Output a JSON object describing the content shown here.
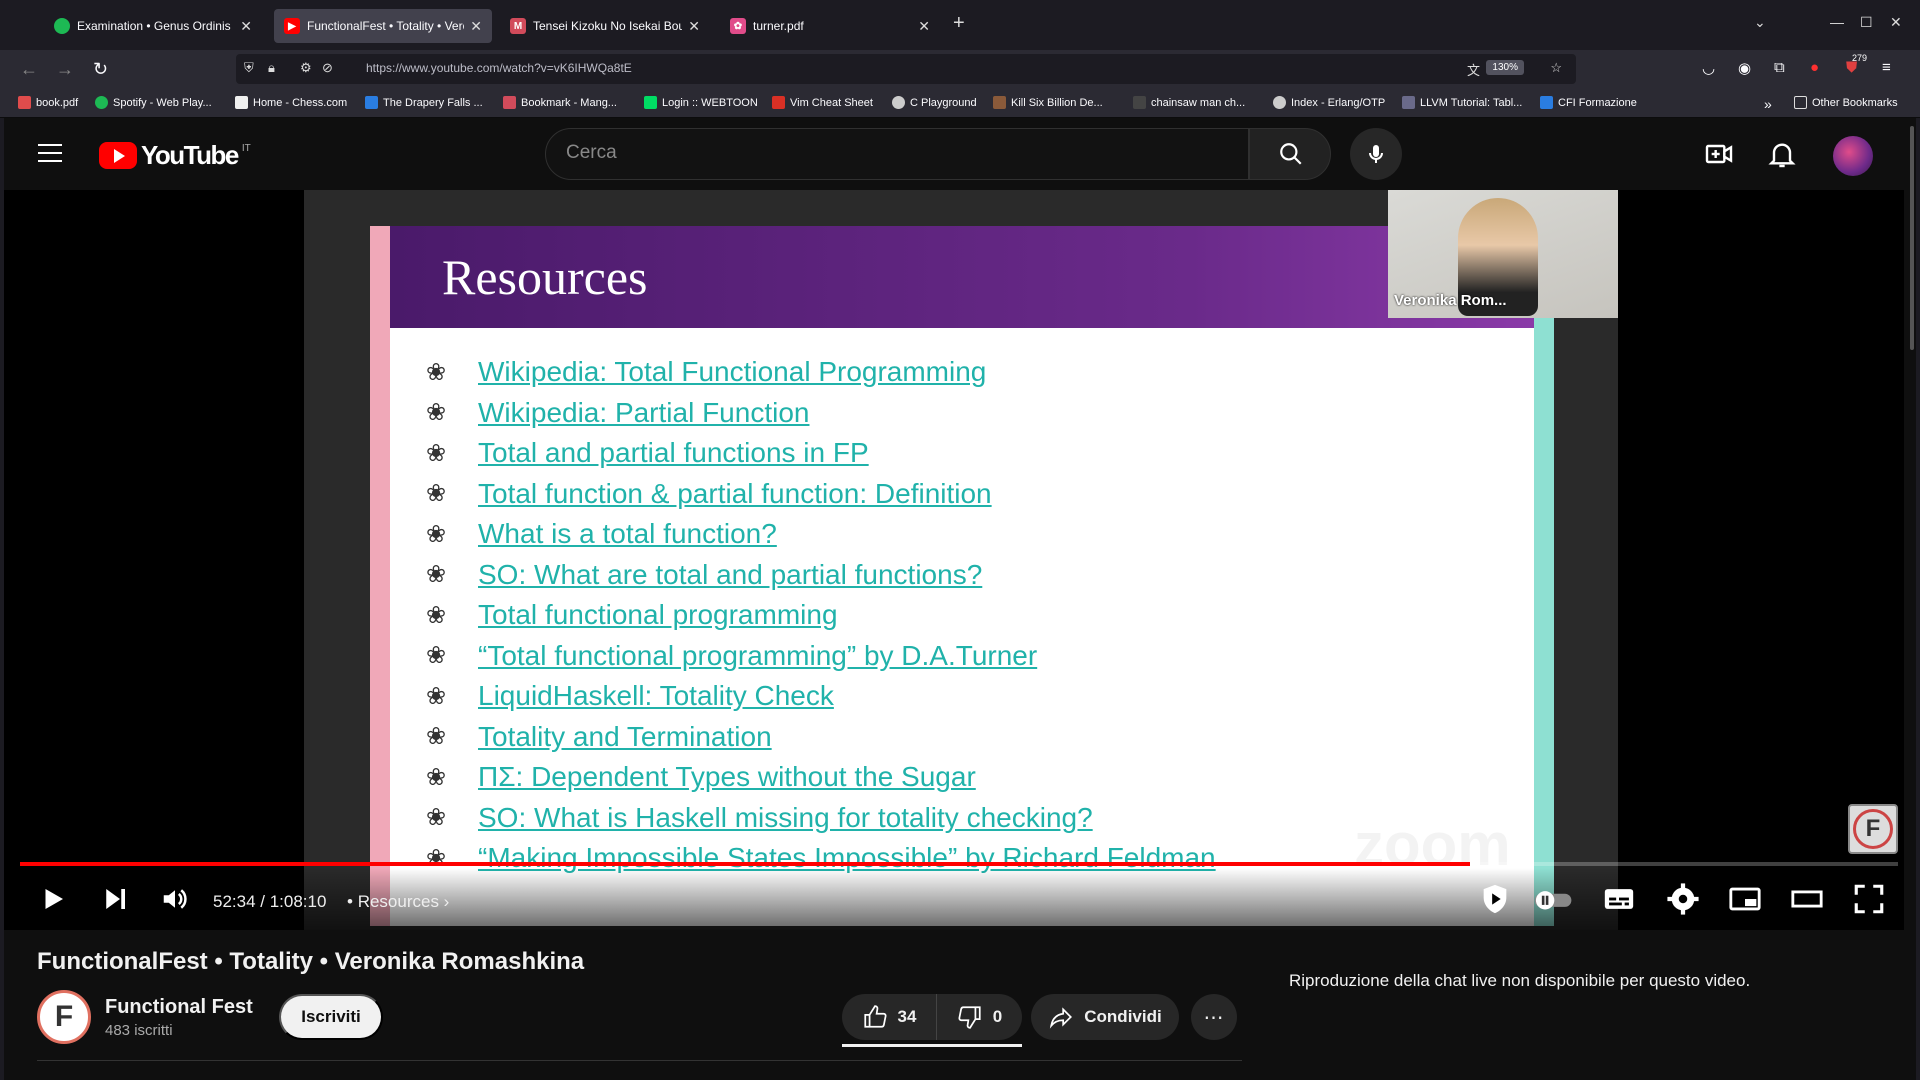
{
  "browser": {
    "tabs": [
      {
        "title": "Examination • Genus Ordinis Dei",
        "favicon_color": "#1db954",
        "active": false
      },
      {
        "title": "FunctionalFest • Totality • Veronika Romashkina",
        "favicon_color": "#ff0000",
        "active": true
      },
      {
        "title": "Tensei Kizoku No Isekai Boukenroku",
        "favicon_color": "#d14b5b",
        "active": false
      },
      {
        "title": "turner.pdf",
        "favicon_color": "#e04c8a",
        "active": false
      }
    ],
    "new_tab_label": "+",
    "url": "https://www.youtube.com/watch?v=vK6IHWQa8tE",
    "zoom": "130%",
    "extension_badge": "279",
    "bookmarks": [
      {
        "label": "book.pdf",
        "color": "#e04c4c"
      },
      {
        "label": "Spotify - Web Play...",
        "color": "#1db954"
      },
      {
        "label": "Home - Chess.com",
        "color": "#f0f0f0"
      },
      {
        "label": "The Drapery Falls ...",
        "color": "#2a7de1"
      },
      {
        "label": "Bookmark - Mang...",
        "color": "#d14b5b"
      },
      {
        "label": "Login :: WEBTOON",
        "color": "#00dc64"
      },
      {
        "label": "Vim Cheat Sheet",
        "color": "#d93025"
      },
      {
        "label": "C Playground",
        "color": "#cccccc"
      },
      {
        "label": "Kill Six Billion De...",
        "color": "#8a5a3a"
      },
      {
        "label": "chainsaw man ch...",
        "color": "#444444"
      },
      {
        "label": "Index - Erlang/OTP",
        "color": "#cccccc"
      },
      {
        "label": "LLVM Tutorial: Tabl...",
        "color": "#6a6a8a"
      },
      {
        "label": "CFI Formazione",
        "color": "#2a7de1"
      }
    ],
    "other_bookmarks": "Other Bookmarks"
  },
  "youtube": {
    "logo_text": "YouTube",
    "country_code": "IT",
    "search_placeholder": "Cerca",
    "avatar_icon": "user-avatar"
  },
  "player": {
    "slide_title": "Resources",
    "links": [
      "Wikipedia: Total Functional Programming",
      "Wikipedia: Partial Function",
      "Total and partial functions in FP",
      "Total function & partial function: Definition",
      "What is a total function?",
      "SO: What are total and partial functions?",
      "Total functional programming",
      "“Total functional programming” by D.A.Turner",
      "LiquidHaskell: Totality Check",
      "Totality and Termination",
      "ΠΣ: Dependent Types without the Sugar",
      "SO: What is Haskell missing for totality checking?",
      "“Making Impossible States Impossible” by Richard Feldman"
    ],
    "webcam_name": "Veronika Rom...",
    "zoom_watermark": "zoom",
    "channel_watermark": "F",
    "time": "52:34 / 1:08:10",
    "chapter": "Resources",
    "progress": 0.772
  },
  "video": {
    "title": "FunctionalFest • Totality • Veronika Romashkina",
    "channel": "Functional Fest",
    "channel_initial": "F",
    "subscribers": "483 iscritti",
    "subscribe_label": "Iscriviti",
    "likes": "34",
    "dislikes": "0",
    "share_label": "Condividi",
    "more_label": "⋯"
  },
  "chat": {
    "message": "Riproduzione della chat live non disponibile per questo video."
  }
}
